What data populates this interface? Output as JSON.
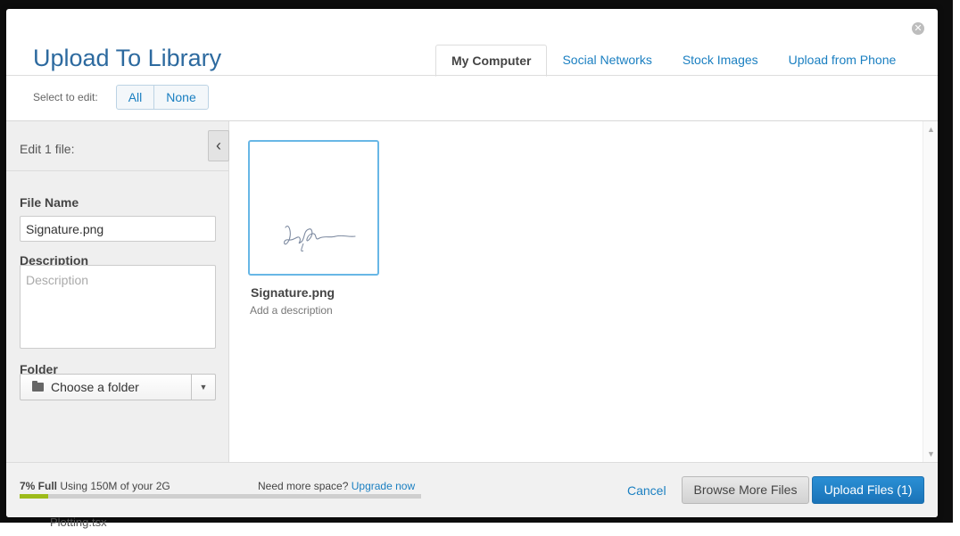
{
  "modal": {
    "title": "Upload To Library",
    "close_glyph": "✕",
    "tabs": [
      {
        "label": "My Computer",
        "active": true
      },
      {
        "label": "Social Networks",
        "active": false
      },
      {
        "label": "Stock Images",
        "active": false
      },
      {
        "label": "Upload from Phone",
        "active": false
      }
    ]
  },
  "select_bar": {
    "label": "Select to edit:",
    "all_label": "All",
    "none_label": "None"
  },
  "sidebar": {
    "edit_heading": "Edit 1 file:",
    "collapse_glyph": "‹",
    "file_name_label": "File Name",
    "file_name_value": "Signature.png",
    "description_label": "Description",
    "description_placeholder": "Description",
    "folder_label": "Folder",
    "folder_value": "Choose a folder",
    "folder_caret": "▼"
  },
  "files": [
    {
      "name": "Signature.png",
      "description_prompt": "Add a description"
    }
  ],
  "footer": {
    "usage_percent": 7,
    "usage_bold": "7% Full",
    "usage_text": "Using 150M of your 2G",
    "need_space": "Need more space?",
    "upgrade_link": "Upgrade now",
    "cancel_label": "Cancel",
    "browse_label": "Browse More Files",
    "upload_label": "Upload Files (1)"
  },
  "background": {
    "partial_text": "Plotting.tsx"
  },
  "colors": {
    "accent_blue": "#1a7fc1",
    "title_blue": "#2d6a9f",
    "usage_green": "#9dbb1b",
    "thumb_border": "#68b7e6"
  },
  "icons": {
    "close": "close-circle-icon",
    "collapse": "chevron-left-icon",
    "folder": "folder-icon",
    "caret": "caret-down-icon",
    "scroll_up": "scroll-up-arrow-icon",
    "scroll_down": "scroll-down-arrow-icon"
  }
}
